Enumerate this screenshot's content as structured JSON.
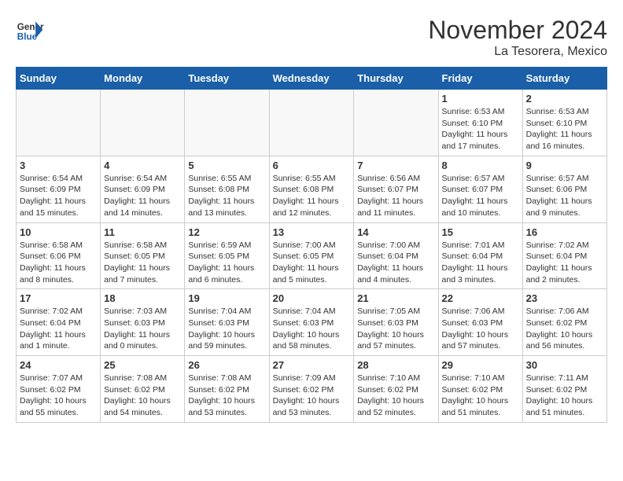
{
  "header": {
    "logo_general": "General",
    "logo_blue": "Blue",
    "month_title": "November 2024",
    "location": "La Tesorera, Mexico"
  },
  "weekdays": [
    "Sunday",
    "Monday",
    "Tuesday",
    "Wednesday",
    "Thursday",
    "Friday",
    "Saturday"
  ],
  "weeks": [
    [
      {
        "day": "",
        "info": ""
      },
      {
        "day": "",
        "info": ""
      },
      {
        "day": "",
        "info": ""
      },
      {
        "day": "",
        "info": ""
      },
      {
        "day": "",
        "info": ""
      },
      {
        "day": "1",
        "info": "Sunrise: 6:53 AM\nSunset: 6:10 PM\nDaylight: 11 hours and 17 minutes."
      },
      {
        "day": "2",
        "info": "Sunrise: 6:53 AM\nSunset: 6:10 PM\nDaylight: 11 hours and 16 minutes."
      }
    ],
    [
      {
        "day": "3",
        "info": "Sunrise: 6:54 AM\nSunset: 6:09 PM\nDaylight: 11 hours and 15 minutes."
      },
      {
        "day": "4",
        "info": "Sunrise: 6:54 AM\nSunset: 6:09 PM\nDaylight: 11 hours and 14 minutes."
      },
      {
        "day": "5",
        "info": "Sunrise: 6:55 AM\nSunset: 6:08 PM\nDaylight: 11 hours and 13 minutes."
      },
      {
        "day": "6",
        "info": "Sunrise: 6:55 AM\nSunset: 6:08 PM\nDaylight: 11 hours and 12 minutes."
      },
      {
        "day": "7",
        "info": "Sunrise: 6:56 AM\nSunset: 6:07 PM\nDaylight: 11 hours and 11 minutes."
      },
      {
        "day": "8",
        "info": "Sunrise: 6:57 AM\nSunset: 6:07 PM\nDaylight: 11 hours and 10 minutes."
      },
      {
        "day": "9",
        "info": "Sunrise: 6:57 AM\nSunset: 6:06 PM\nDaylight: 11 hours and 9 minutes."
      }
    ],
    [
      {
        "day": "10",
        "info": "Sunrise: 6:58 AM\nSunset: 6:06 PM\nDaylight: 11 hours and 8 minutes."
      },
      {
        "day": "11",
        "info": "Sunrise: 6:58 AM\nSunset: 6:05 PM\nDaylight: 11 hours and 7 minutes."
      },
      {
        "day": "12",
        "info": "Sunrise: 6:59 AM\nSunset: 6:05 PM\nDaylight: 11 hours and 6 minutes."
      },
      {
        "day": "13",
        "info": "Sunrise: 7:00 AM\nSunset: 6:05 PM\nDaylight: 11 hours and 5 minutes."
      },
      {
        "day": "14",
        "info": "Sunrise: 7:00 AM\nSunset: 6:04 PM\nDaylight: 11 hours and 4 minutes."
      },
      {
        "day": "15",
        "info": "Sunrise: 7:01 AM\nSunset: 6:04 PM\nDaylight: 11 hours and 3 minutes."
      },
      {
        "day": "16",
        "info": "Sunrise: 7:02 AM\nSunset: 6:04 PM\nDaylight: 11 hours and 2 minutes."
      }
    ],
    [
      {
        "day": "17",
        "info": "Sunrise: 7:02 AM\nSunset: 6:04 PM\nDaylight: 11 hours and 1 minute."
      },
      {
        "day": "18",
        "info": "Sunrise: 7:03 AM\nSunset: 6:03 PM\nDaylight: 11 hours and 0 minutes."
      },
      {
        "day": "19",
        "info": "Sunrise: 7:04 AM\nSunset: 6:03 PM\nDaylight: 10 hours and 59 minutes."
      },
      {
        "day": "20",
        "info": "Sunrise: 7:04 AM\nSunset: 6:03 PM\nDaylight: 10 hours and 58 minutes."
      },
      {
        "day": "21",
        "info": "Sunrise: 7:05 AM\nSunset: 6:03 PM\nDaylight: 10 hours and 57 minutes."
      },
      {
        "day": "22",
        "info": "Sunrise: 7:06 AM\nSunset: 6:03 PM\nDaylight: 10 hours and 57 minutes."
      },
      {
        "day": "23",
        "info": "Sunrise: 7:06 AM\nSunset: 6:02 PM\nDaylight: 10 hours and 56 minutes."
      }
    ],
    [
      {
        "day": "24",
        "info": "Sunrise: 7:07 AM\nSunset: 6:02 PM\nDaylight: 10 hours and 55 minutes."
      },
      {
        "day": "25",
        "info": "Sunrise: 7:08 AM\nSunset: 6:02 PM\nDaylight: 10 hours and 54 minutes."
      },
      {
        "day": "26",
        "info": "Sunrise: 7:08 AM\nSunset: 6:02 PM\nDaylight: 10 hours and 53 minutes."
      },
      {
        "day": "27",
        "info": "Sunrise: 7:09 AM\nSunset: 6:02 PM\nDaylight: 10 hours and 53 minutes."
      },
      {
        "day": "28",
        "info": "Sunrise: 7:10 AM\nSunset: 6:02 PM\nDaylight: 10 hours and 52 minutes."
      },
      {
        "day": "29",
        "info": "Sunrise: 7:10 AM\nSunset: 6:02 PM\nDaylight: 10 hours and 51 minutes."
      },
      {
        "day": "30",
        "info": "Sunrise: 7:11 AM\nSunset: 6:02 PM\nDaylight: 10 hours and 51 minutes."
      }
    ]
  ]
}
